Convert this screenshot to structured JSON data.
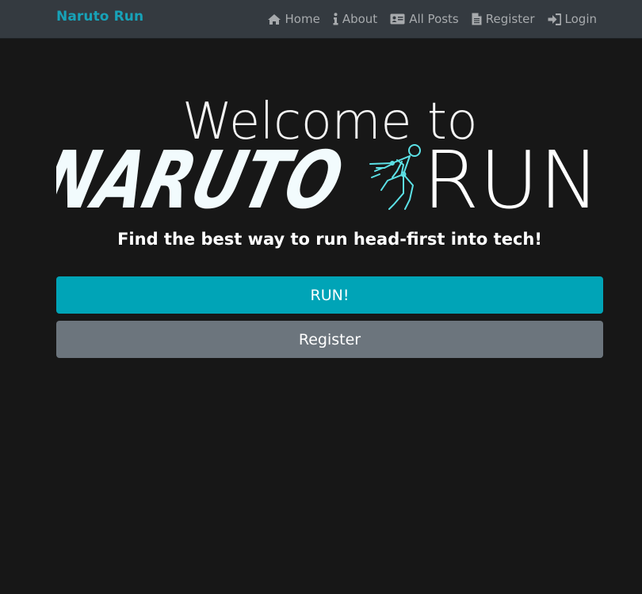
{
  "navbar": {
    "brand": "Naruto Run",
    "links": [
      {
        "label": "Home",
        "icon": "home-icon"
      },
      {
        "label": "About",
        "icon": "info-icon"
      },
      {
        "label": "All Posts",
        "icon": "id-card-icon"
      },
      {
        "label": "Register",
        "icon": "file-icon"
      },
      {
        "label": "Login",
        "icon": "sign-in-icon"
      }
    ]
  },
  "hero": {
    "welcome": "Welcome to",
    "logo_left": "NARUTO",
    "logo_right": "RUN",
    "tagline": "Find the best way to run head-first into tech!"
  },
  "actions": {
    "run_label": "RUN!",
    "register_label": "Register"
  },
  "colors": {
    "accent": "#17a2b8",
    "run_button": "#00a4b7",
    "register_button": "#6c757d",
    "background": "#171717",
    "navbar": "#343a40",
    "runner_figure": "#5ce1e6"
  }
}
